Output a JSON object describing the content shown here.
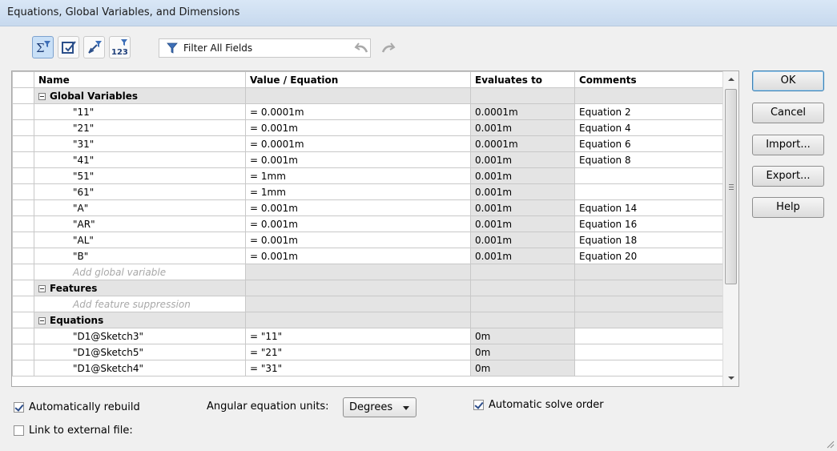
{
  "window": {
    "title": "Equations, Global Variables, and Dimensions"
  },
  "toolbar": {
    "buttons": [
      {
        "name": "equation-view-icon",
        "active": true
      },
      {
        "name": "sketch-equation-view-icon",
        "active": false
      },
      {
        "name": "dimension-view-icon",
        "active": false
      },
      {
        "name": "ordered-view-icon",
        "active": false
      }
    ],
    "filter_label": "Filter All Fields"
  },
  "grid": {
    "headers": {
      "name": "Name",
      "value": "Value / Equation",
      "evaluates": "Evaluates to",
      "comments": "Comments"
    },
    "groups": {
      "global": "Global Variables",
      "features": "Features",
      "equations": "Equations"
    },
    "global_rows": [
      {
        "name": "\"11\"",
        "value": "= 0.0001m",
        "evaluates": "0.0001m",
        "comment": "Equation  2"
      },
      {
        "name": "\"21\"",
        "value": "= 0.001m",
        "evaluates": "0.001m",
        "comment": "Equation  4"
      },
      {
        "name": "\"31\"",
        "value": "= 0.0001m",
        "evaluates": "0.0001m",
        "comment": "Equation  6"
      },
      {
        "name": "\"41\"",
        "value": "= 0.001m",
        "evaluates": "0.001m",
        "comment": "Equation  8"
      },
      {
        "name": "\"51\"",
        "value": "= 1mm",
        "evaluates": "0.001m",
        "comment": ""
      },
      {
        "name": "\"61\"",
        "value": "= 1mm",
        "evaluates": "0.001m",
        "comment": ""
      },
      {
        "name": "\"A\"",
        "value": "= 0.001m",
        "evaluates": "0.001m",
        "comment": "Equation 14"
      },
      {
        "name": "\"AR\"",
        "value": "= 0.001m",
        "evaluates": "0.001m",
        "comment": "Equation 16"
      },
      {
        "name": "\"AL\"",
        "value": "= 0.001m",
        "evaluates": "0.001m",
        "comment": "Equation 18"
      },
      {
        "name": "\"B\"",
        "value": "= 0.001m",
        "evaluates": "0.001m",
        "comment": "Equation 20"
      }
    ],
    "add_global_placeholder": "Add global variable",
    "add_feature_placeholder": "Add feature suppression",
    "equation_rows": [
      {
        "name": "\"D1@Sketch3\"",
        "value": "= \"11\"",
        "evaluates": "0m",
        "comment": ""
      },
      {
        "name": "\"D1@Sketch5\"",
        "value": "= \"21\"",
        "evaluates": "0m",
        "comment": ""
      },
      {
        "name": "\"D1@Sketch4\"",
        "value": "= \"31\"",
        "evaluates": "0m",
        "comment": ""
      }
    ]
  },
  "buttons": {
    "ok": "OK",
    "cancel": "Cancel",
    "import": "Import...",
    "export": "Export...",
    "help": "Help"
  },
  "options": {
    "auto_rebuild": {
      "label": "Automatically rebuild",
      "checked": true
    },
    "link_external": {
      "label": "Link to external file:",
      "checked": false
    },
    "angular_units_label": "Angular equation units:",
    "angular_units_value": "Degrees",
    "auto_solve": {
      "label": "Automatic solve order",
      "checked": true
    }
  }
}
